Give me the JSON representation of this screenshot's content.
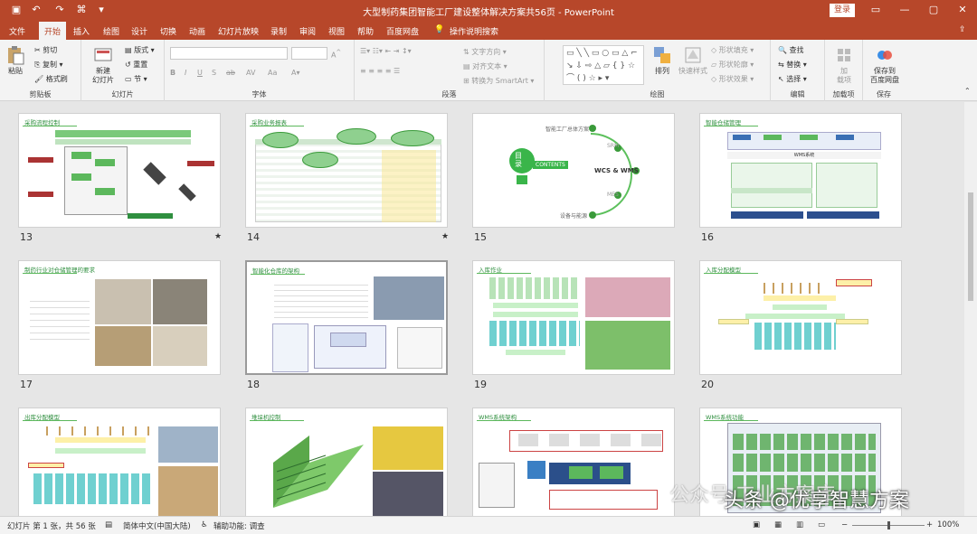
{
  "window": {
    "title": "大型制药集团智能工厂建设整体解决方案共56页 - PowerPoint",
    "login_label": "登录"
  },
  "tabs": [
    "文件",
    "开始",
    "插入",
    "绘图",
    "设计",
    "切换",
    "动画",
    "幻灯片放映",
    "录制",
    "审阅",
    "视图",
    "帮助",
    "百度网盘",
    "操作说明搜索"
  ],
  "active_tab": "开始",
  "ribbon": {
    "clipboard": {
      "label": "剪贴板",
      "paste": "粘贴",
      "cut": "剪切",
      "copy": "复制",
      "format_painter": "格式刷"
    },
    "slides": {
      "label": "幻灯片",
      "new_slide": "新建\n幻灯片",
      "layout": "版式",
      "reset": "重置",
      "section": "节"
    },
    "font": {
      "label": "字体"
    },
    "paragraph": {
      "label": "段落",
      "text_direction": "文字方向",
      "align_text": "对齐文本",
      "convert_smartart": "转换为 SmartArt"
    },
    "drawing": {
      "label": "绘图",
      "arrange": "排列",
      "quick_styles": "快速样式",
      "shape_fill": "形状填充",
      "shape_outline": "形状轮廓",
      "shape_effects": "形状效果"
    },
    "editing": {
      "label": "编辑",
      "find": "查找",
      "replace": "替换",
      "select": "选择"
    },
    "addins": {
      "label": "加载项",
      "addin": "加\n载项"
    },
    "save": {
      "label": "保存",
      "save_baidu": "保存到\n百度网盘"
    }
  },
  "slides": [
    {
      "number": "13",
      "title": "采购流程控制",
      "star": "★"
    },
    {
      "number": "14",
      "title": "采购业务报表",
      "star": "★"
    },
    {
      "number": "15",
      "title": "",
      "contents_word": "目\n录",
      "contents_label": "CONTENTS",
      "items": [
        "智能工厂总体方案",
        "SRM",
        "WCS & WMS",
        "MES",
        "设备与能源"
      ],
      "center": "WCS & WMS"
    },
    {
      "number": "16",
      "title": "智能仓储管理",
      "wms_label": "WMS系统"
    },
    {
      "number": "17",
      "title": "制药行业对仓储管理的要求"
    },
    {
      "number": "18",
      "title": "智能化仓库的架构",
      "selected": true
    },
    {
      "number": "19",
      "title": "入库作业"
    },
    {
      "number": "20",
      "title": "入库分配模型"
    },
    {
      "number": "",
      "title": "出库分配模型"
    },
    {
      "number": "",
      "title": "堆垛机控制"
    },
    {
      "number": "",
      "title": "WMS系统架构"
    },
    {
      "number": "",
      "title": "WMS系统功能"
    }
  ],
  "status": {
    "slide_info": "幻灯片 第 1 张，共 56 张",
    "language": "简体中文(中国大陆)",
    "accessibility": "辅助功能: 调查",
    "zoom": "100%"
  },
  "watermark": {
    "text": "头条 @优享智慧方案",
    "logo_text": "公众号·工业方案库"
  },
  "colors": {
    "titlebar": "#b7472a",
    "accent_green": "#2f8f3f",
    "ribbon_bg": "#f3f3f3"
  }
}
